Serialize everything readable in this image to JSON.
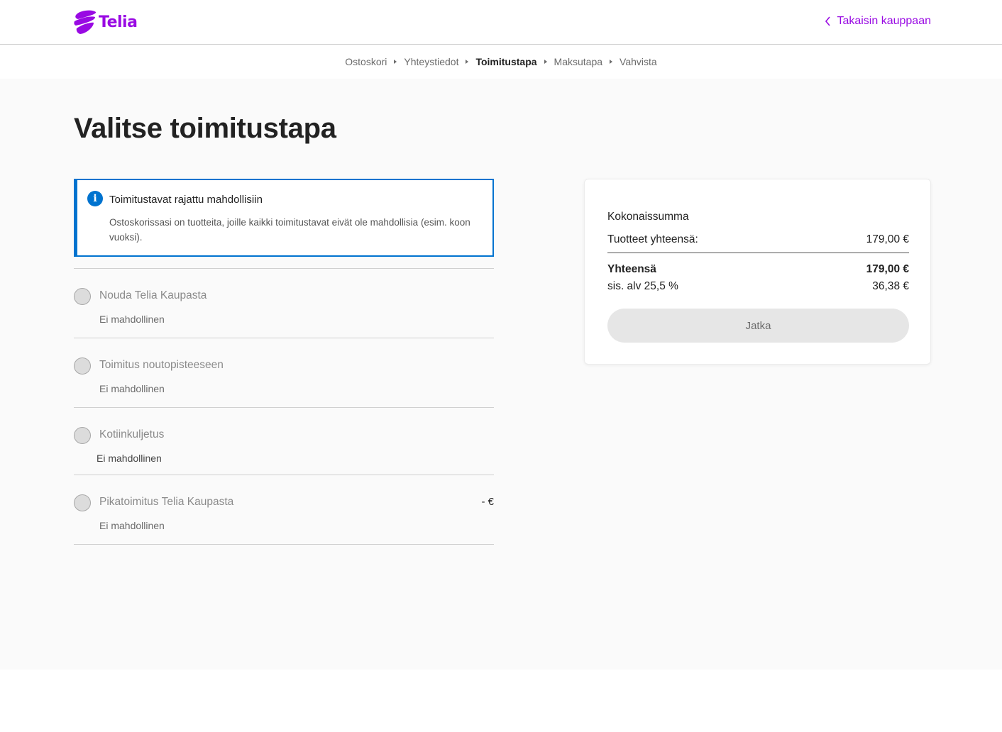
{
  "header": {
    "logo_text": "Telia",
    "back_label": "Takaisin kauppaan",
    "brand_color": "#990ae3"
  },
  "steps": [
    {
      "label": "Ostoskori",
      "active": false
    },
    {
      "label": "Yhteystiedot",
      "active": false
    },
    {
      "label": "Toimitustapa",
      "active": true
    },
    {
      "label": "Maksutapa",
      "active": false
    },
    {
      "label": "Vahvista",
      "active": false
    }
  ],
  "page_title": "Valitse toimitustapa",
  "info": {
    "icon": "info-icon",
    "title": "Toimitustavat rajattu mahdollisiin",
    "text": "Ostoskorissasi on tuotteita, joille kaikki toimitustavat eivät ole mahdollisia (esim. koon vuoksi).",
    "color": "#0073cf"
  },
  "delivery_options": [
    {
      "title": "Nouda Telia Kaupasta",
      "status": "Ei mahdollinen",
      "price": ""
    },
    {
      "title": "Toimitus noutopisteeseen",
      "status": "Ei mahdollinen",
      "price": ""
    },
    {
      "title": "Kotiinkuljetus",
      "status": "Ei mahdollinen",
      "price": ""
    },
    {
      "title": "Pikatoimitus Telia Kaupasta",
      "status": "Ei mahdollinen",
      "price": "- €"
    }
  ],
  "summary": {
    "heading": "Kokonaissumma",
    "products_label": "Tuotteet yhteensä:",
    "products_value": "179,00 €",
    "total_label": "Yhteensä",
    "total_value": "179,00 €",
    "vat_label": "sis. alv 25,5 %",
    "vat_value": "36,38 €",
    "continue_label": "Jatka"
  }
}
